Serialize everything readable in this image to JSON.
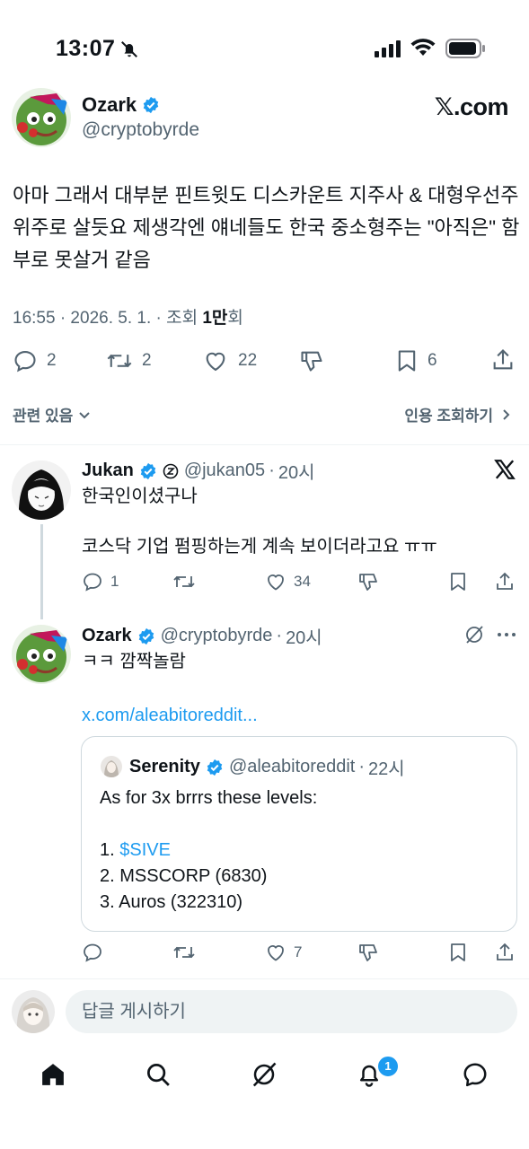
{
  "status_bar": {
    "time": "13:07"
  },
  "brand": {
    "label": "𝕏.com"
  },
  "main_tweet": {
    "name": "Ozark",
    "handle": "@cryptobyrde",
    "body": "아마 그래서 대부분 핀트윗도 디스카운트 지주사 & 대형우선주 위주로 살듯요 제생각엔 얘네들도 한국 중소형주는 \"아직은\" 함부로 못살거 같음",
    "meta_prefix": "16:55 · 2026. 5. 1. · 조회 ",
    "views": "1만",
    "views_suffix": "회",
    "replies": "2",
    "reposts": "2",
    "likes": "22",
    "bookmarks": "6"
  },
  "related": {
    "left_label": "관련 있음",
    "right_label": "인용 조회하기"
  },
  "reply_1": {
    "name": "Jukan",
    "handle": "@jukan05",
    "time": "20시",
    "line1": "한국인이셨구나",
    "line2": "코스닥 기업 펌핑하는게 계속 보이더라고요 ㅠㅠ",
    "replies": "1",
    "likes": "34"
  },
  "reply_2": {
    "name": "Ozark",
    "handle": "@cryptobyrde",
    "time": "20시",
    "line1": "ㅋㅋ 깜짝놀람",
    "link": "x.com/aleabitoreddit...",
    "likes": "7",
    "quote": {
      "name": "Serenity",
      "handle": "@aleabitoreddit",
      "time": "22시",
      "line1": "As for 3x brrrs these levels:",
      "item1_prefix": "1. ",
      "item1_ticker": "$SIVE",
      "item2": "2. MSSCORP (6830)",
      "item3": "3. Auros (322310)"
    }
  },
  "reply_bar": {
    "placeholder": "답글 게시하기"
  },
  "nav": {
    "notif_count": "1"
  },
  "colors": {
    "accent": "#1d9bf0",
    "text": "#0f1419",
    "muted": "#536471"
  }
}
